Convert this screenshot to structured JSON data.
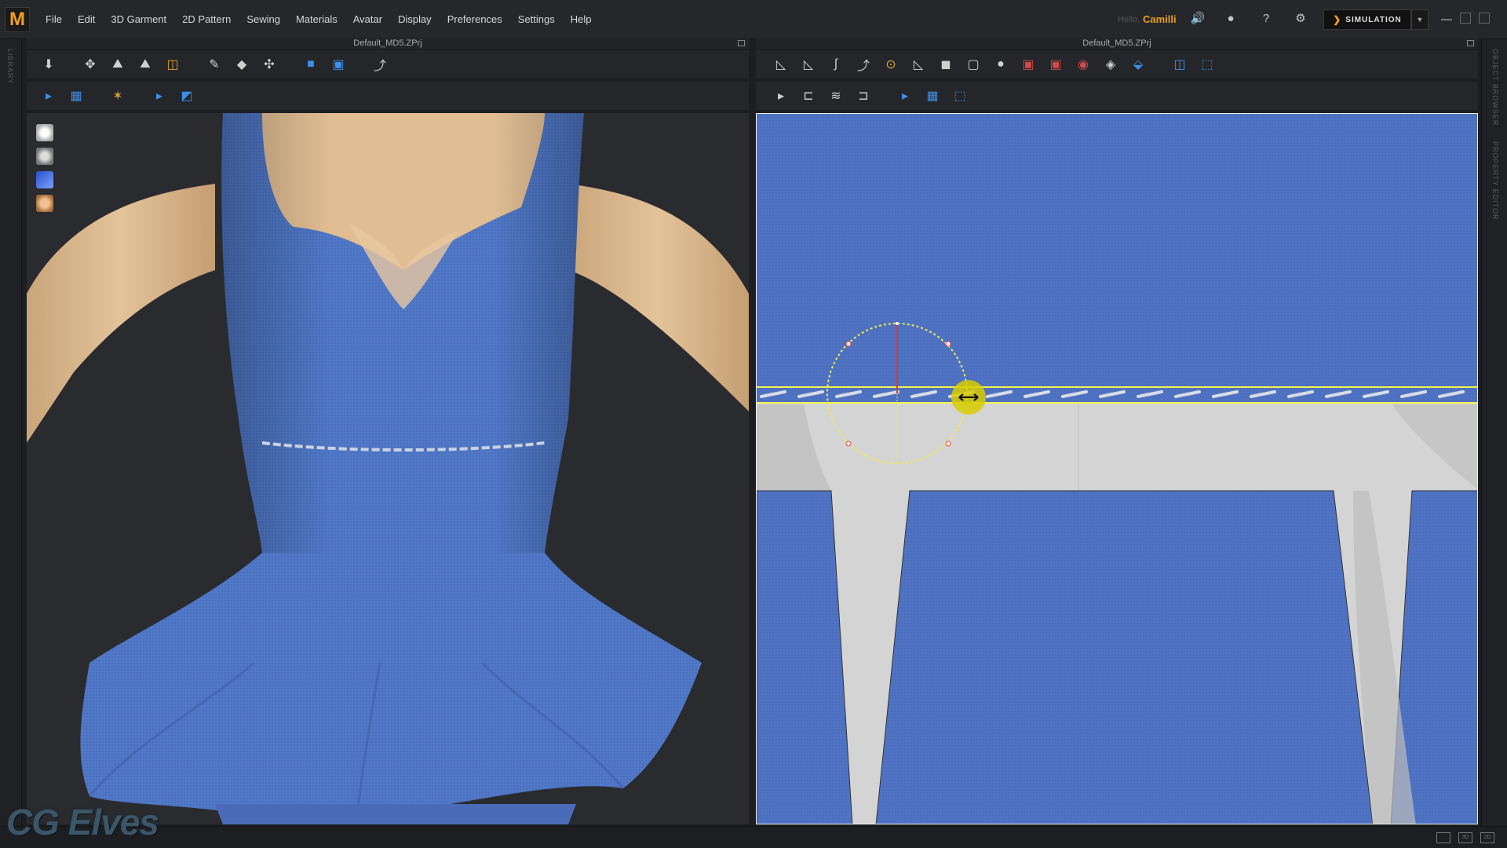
{
  "app": {
    "logo": "M",
    "menu": [
      "File",
      "Edit",
      "3D Garment",
      "2D Pattern",
      "Sewing",
      "Materials",
      "Avatar",
      "Display",
      "Preferences",
      "Settings",
      "Help"
    ],
    "greeting": "Hello,",
    "username": "Camilli",
    "mode_button": "SIMULATION"
  },
  "side_labels": {
    "left": "LIBRARY",
    "right_top": "OBJECT BROWSER",
    "right_bottom": "PROPERTY EDITOR"
  },
  "panels": {
    "left_title": "Default_MD5.ZPrj",
    "right_title": "Default_MD5.ZPrj"
  },
  "toolbar_3d": {
    "row1": [
      "import-arrow-icon",
      "transform-move-icon",
      "fold-arrangement-icon",
      "fold-icon",
      "gizmo-tack-icon",
      "pin-icon",
      "select-mesh-icon",
      "measure-avatar-icon",
      "avatar-front-icon",
      "avatar-back-icon",
      "fold-line-icon"
    ],
    "row2": [
      "edit-texture-icon",
      "checker-icon",
      "arrangement-point-icon",
      "select-fabric-icon",
      "fabric-show-icon"
    ]
  },
  "toolbar_2d": {
    "row1": [
      "segment-edit-icon",
      "polygon-icon",
      "curve-icon",
      "curve-point-icon",
      "add-point-icon",
      "edit-curvature-icon",
      "rectangle-icon",
      "square-icon",
      "circle-icon",
      "internal-polygon-icon",
      "internal-rect-icon",
      "internal-circle-icon",
      "darts-icon",
      "trace-icon",
      "sewing-edit-icon",
      "seam-allowance-icon"
    ],
    "row2": [
      "segment-sewing-icon",
      "free-sewing-icon",
      "multi-sewing-icon",
      "check-sewing-icon",
      "edit-texture-2d-icon",
      "checker-2d-icon",
      "unfold-icon"
    ]
  },
  "avatar_visibility_icons": [
    "show-garment-icon",
    "show-avatar-icon",
    "show-fabric-icon",
    "show-skin-icon"
  ],
  "colors": {
    "fabric": "#4f73c2",
    "accent": "#f0a020",
    "seam_highlight": "#f5f34a",
    "pattern_bg": "#d4d4d4"
  },
  "watermark": "CG Elves"
}
